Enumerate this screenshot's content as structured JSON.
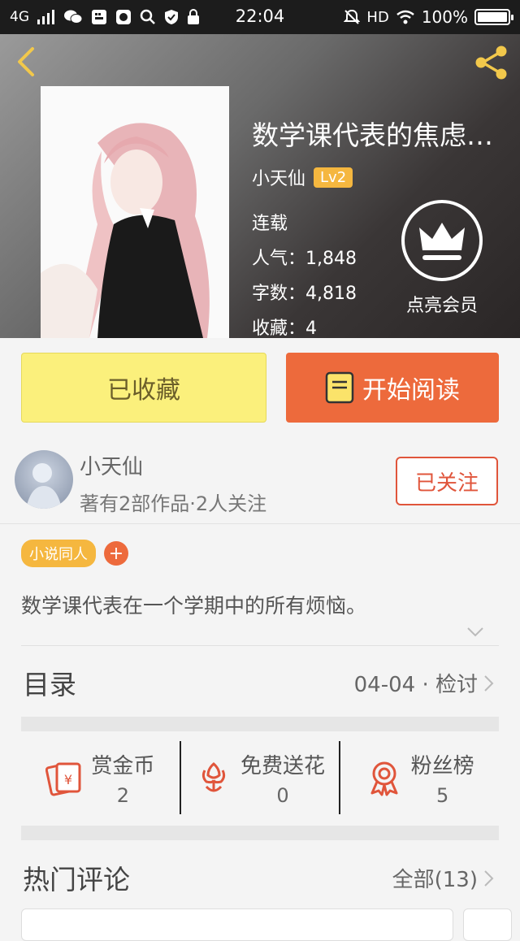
{
  "statusbar": {
    "network": "4G",
    "time": "22:04",
    "hd": "HD",
    "battery": "100%"
  },
  "book": {
    "title": "数学课代表的焦虑…",
    "author": "小天仙",
    "level": "Lv2",
    "status": "连载",
    "popularity": "人气：1,848",
    "word_count": "字数：4,818",
    "favorites": "收藏：4"
  },
  "vip": {
    "label": "点亮会员"
  },
  "actions": {
    "favorited_label": "已收藏",
    "read_label": "开始阅读"
  },
  "author_card": {
    "name": "小天仙",
    "summary": "著有2部作品·2人关注",
    "follow_label": "已关注"
  },
  "tags": {
    "items": [
      "小说同人"
    ],
    "add_label": "+"
  },
  "description": "数学课代表在一个学期中的所有烦恼。",
  "toc": {
    "label": "目录",
    "latest": "04-04 · 检讨"
  },
  "stats": [
    {
      "label": "赏金币",
      "value": "2",
      "icon": "red-envelope-icon"
    },
    {
      "label": "免费送花",
      "value": "0",
      "icon": "flower-icon"
    },
    {
      "label": "粉丝榜",
      "value": "5",
      "icon": "medal-icon"
    }
  ],
  "comments": {
    "label": "热门评论",
    "all_label": "全部(13)"
  },
  "colors": {
    "accent": "#ed6a3c",
    "favorite": "#fbf07c",
    "badge": "#f5b73f"
  }
}
